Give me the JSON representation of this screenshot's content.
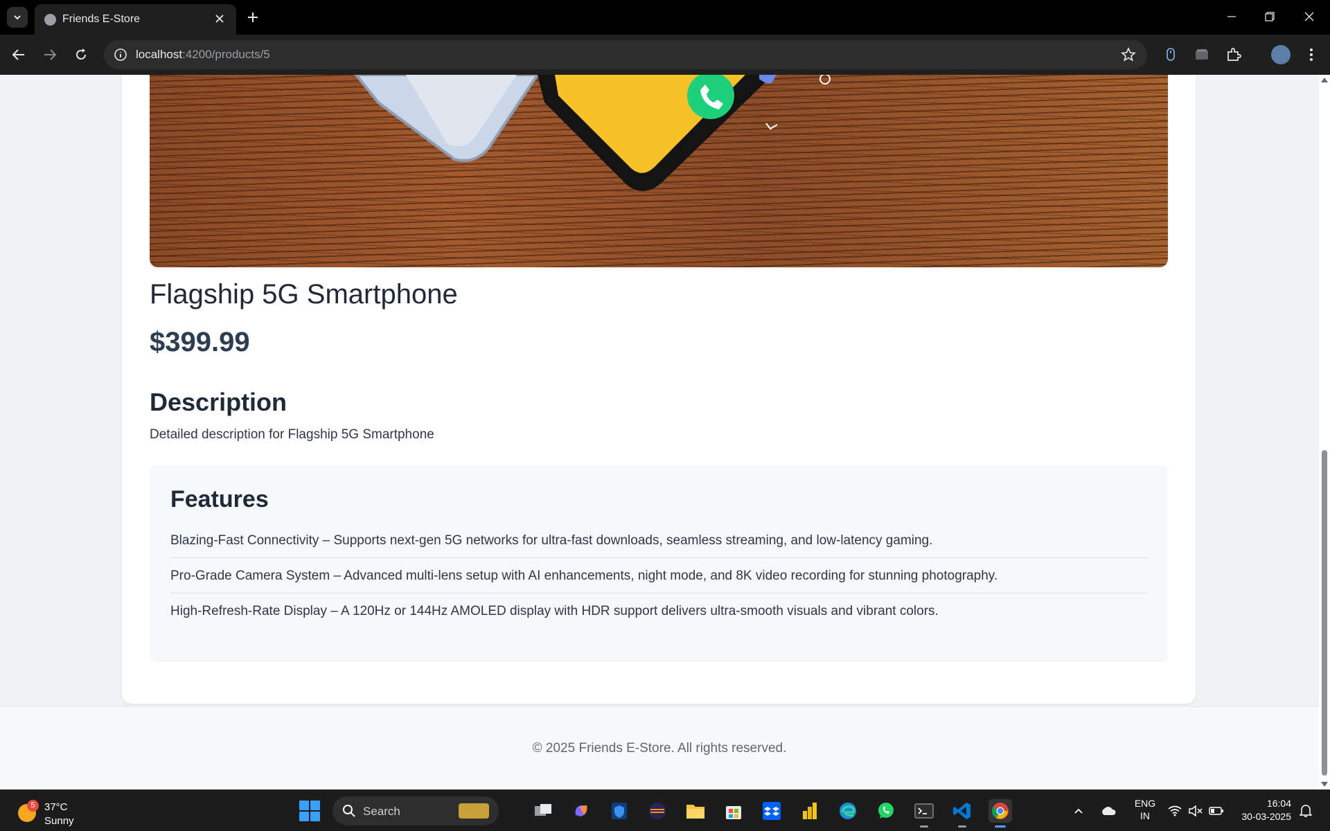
{
  "browser": {
    "tab_title": "Friends E-Store",
    "url_host": "localhost",
    "url_path": ":4200/products/5"
  },
  "product": {
    "name": "Flagship 5G Smartphone",
    "price": "$399.99",
    "description_heading": "Description",
    "description": "Detailed description for Flagship 5G Smartphone",
    "features_heading": "Features",
    "features": [
      "Blazing-Fast Connectivity – Supports next-gen 5G networks for ultra-fast downloads, seamless streaming, and low-latency gaming.",
      "Pro-Grade Camera System – Advanced multi-lens setup with AI enhancements, night mode, and 8K video recording for stunning photography.",
      "High-Refresh-Rate Display – A 120Hz or 144Hz AMOLED display with HDR support delivers ultra-smooth visuals and vibrant colors."
    ]
  },
  "footer": {
    "text": "© 2025 Friends E-Store. All rights reserved."
  },
  "taskbar": {
    "weather_badge": "5",
    "temperature": "37°C",
    "condition": "Sunny",
    "search_label": "Search",
    "lang_line1": "ENG",
    "lang_line2": "IN",
    "time": "16:04",
    "date": "30-03-2025"
  },
  "colors": {
    "price": "#2c3e50",
    "features_bg": "#f6f8fa",
    "browser_dark": "#1f1f1f"
  }
}
